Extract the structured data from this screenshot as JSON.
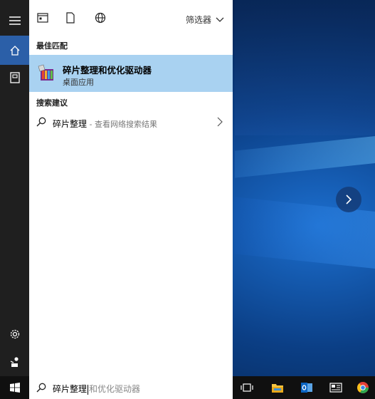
{
  "panel": {
    "filter_label": "筛选器",
    "best_match_header": "最佳匹配",
    "best_match": {
      "title": "碎片整理和优化驱动器",
      "subtitle": "桌面应用"
    },
    "suggestions_header": "搜索建议",
    "suggestion": {
      "query": "碎片整理",
      "hint": " - 查看网络搜索结果"
    }
  },
  "taskbar": {
    "search_typed": "碎片整理",
    "search_completion": "和优化驱动器"
  },
  "colors": {
    "highlight": "#a9d2f1",
    "rail": "#1f1f1f",
    "rail_active": "#2b5fa8",
    "taskbar": "#101010"
  },
  "icons": {
    "rail": [
      "hamburger-icon",
      "home-icon",
      "notebook-icon",
      "gear-icon",
      "feedback-icon"
    ],
    "filters": [
      "apps-filter-icon",
      "documents-filter-icon",
      "web-filter-icon"
    ],
    "taskbar": [
      "windows-start-icon",
      "task-view-icon",
      "file-explorer-icon",
      "outlook-icon",
      "news-icon",
      "chrome-icon"
    ]
  }
}
